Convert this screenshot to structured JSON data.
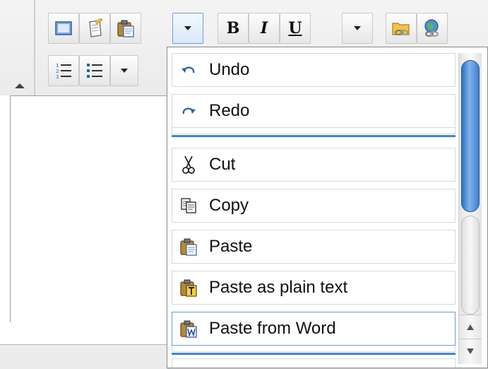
{
  "toolbar": {
    "row1": [
      {
        "name": "source-button",
        "icon": "document-icon"
      },
      {
        "name": "new-page-button",
        "icon": "new-page-icon"
      },
      {
        "name": "paste-button",
        "icon": "clipboard-icon"
      },
      {
        "name": "more-button",
        "icon": "chevron-down-icon",
        "active": true
      },
      {
        "name": "bold-button",
        "text": "B"
      },
      {
        "name": "italic-button",
        "text": "I"
      },
      {
        "name": "underline-button",
        "text": "U"
      },
      {
        "name": "format-more-button",
        "icon": "chevron-down-icon"
      },
      {
        "name": "link-button",
        "icon": "folder-link-icon"
      },
      {
        "name": "unlink-button",
        "icon": "globe-link-icon"
      }
    ],
    "row2": [
      {
        "name": "numbered-list-button",
        "icon": "numbered-list-icon"
      },
      {
        "name": "bulleted-list-button",
        "icon": "bulleted-list-icon"
      },
      {
        "name": "list-more-button",
        "icon": "chevron-down-icon"
      }
    ]
  },
  "menu": {
    "items": [
      {
        "label": "Undo",
        "icon": "undo-icon"
      },
      {
        "label": "Redo",
        "icon": "redo-icon"
      },
      {
        "label": "Cut",
        "icon": "scissors-icon"
      },
      {
        "label": "Copy",
        "icon": "copy-icon"
      },
      {
        "label": "Paste",
        "icon": "paste-icon"
      },
      {
        "label": "Paste as plain text",
        "icon": "paste-text-icon"
      },
      {
        "label": "Paste from Word",
        "icon": "paste-word-icon",
        "hover": true
      }
    ]
  },
  "colors": {
    "accent": "#3f86cf",
    "scroll_thumb": "#2b6fc0"
  }
}
